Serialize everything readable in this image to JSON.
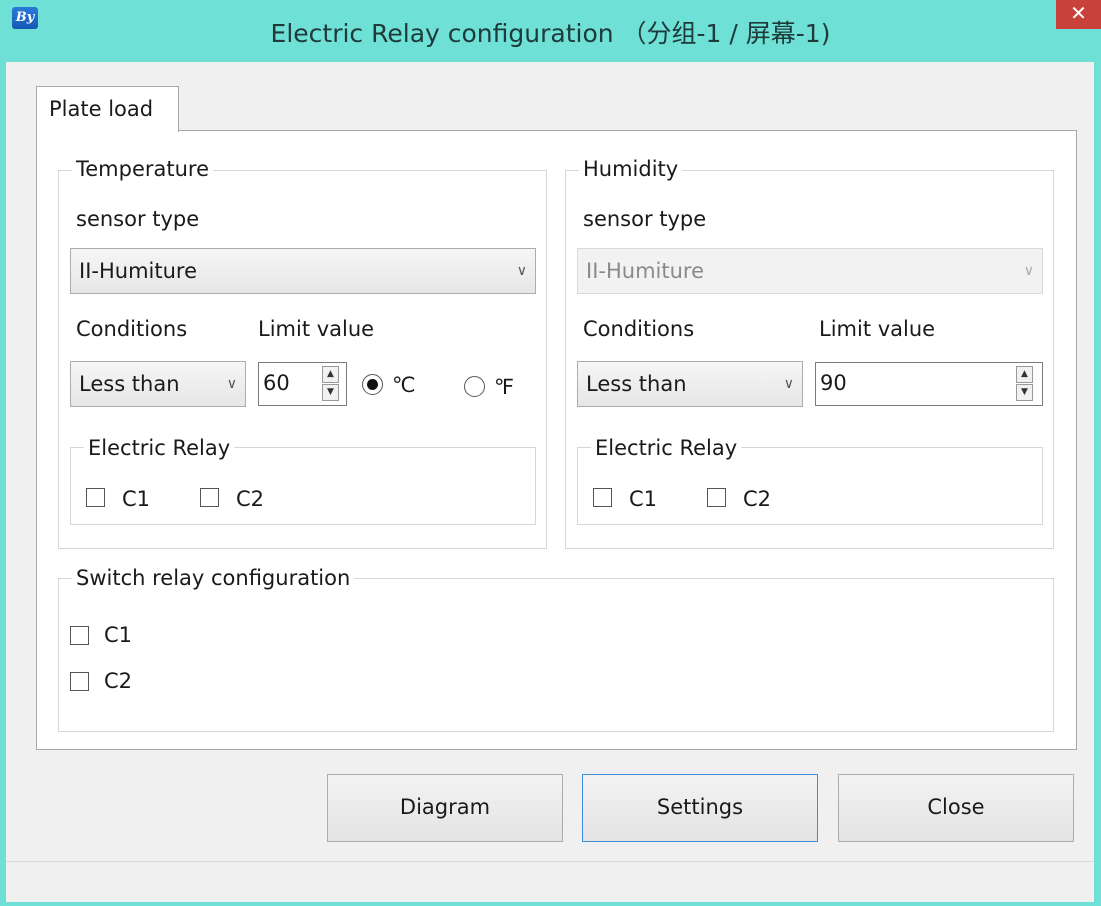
{
  "window": {
    "title": "Electric Relay configuration （分组-1 / 屏幕-1)",
    "icon": "app-logo-icon",
    "close_glyph": "✕"
  },
  "tabs": [
    {
      "label": "Plate load",
      "active": true
    }
  ],
  "temperature": {
    "legend": "Temperature",
    "sensor_type_label": "sensor type",
    "sensor_type_value": "II-Humiture",
    "conditions_label": "Conditions",
    "limit_label": "Limit value",
    "conditions_value": "Less than",
    "limit_value": "60",
    "unit_c": "℃",
    "unit_f": "℉",
    "unit_selected": "℃",
    "relay": {
      "legend": "Electric Relay",
      "options": [
        {
          "label": "C1",
          "checked": false
        },
        {
          "label": "C2",
          "checked": false
        }
      ]
    }
  },
  "humidity": {
    "legend": "Humidity",
    "sensor_type_label": "sensor type",
    "sensor_type_value": "II-Humiture",
    "sensor_disabled": true,
    "conditions_label": "Conditions",
    "limit_label": "Limit value",
    "conditions_value": "Less than",
    "limit_value": "90",
    "relay": {
      "legend": "Electric Relay",
      "options": [
        {
          "label": "C1",
          "checked": false
        },
        {
          "label": "C2",
          "checked": false
        }
      ]
    }
  },
  "switch_relay": {
    "legend": "Switch relay configuration",
    "options": [
      {
        "label": "C1",
        "checked": false
      },
      {
        "label": "C2",
        "checked": false
      }
    ]
  },
  "buttons": {
    "diagram": "Diagram",
    "settings": "Settings",
    "close": "Close"
  },
  "colors": {
    "titlebar": "#6ee0d6",
    "close_button": "#c8413b",
    "focus_border": "#3c8fd8"
  }
}
